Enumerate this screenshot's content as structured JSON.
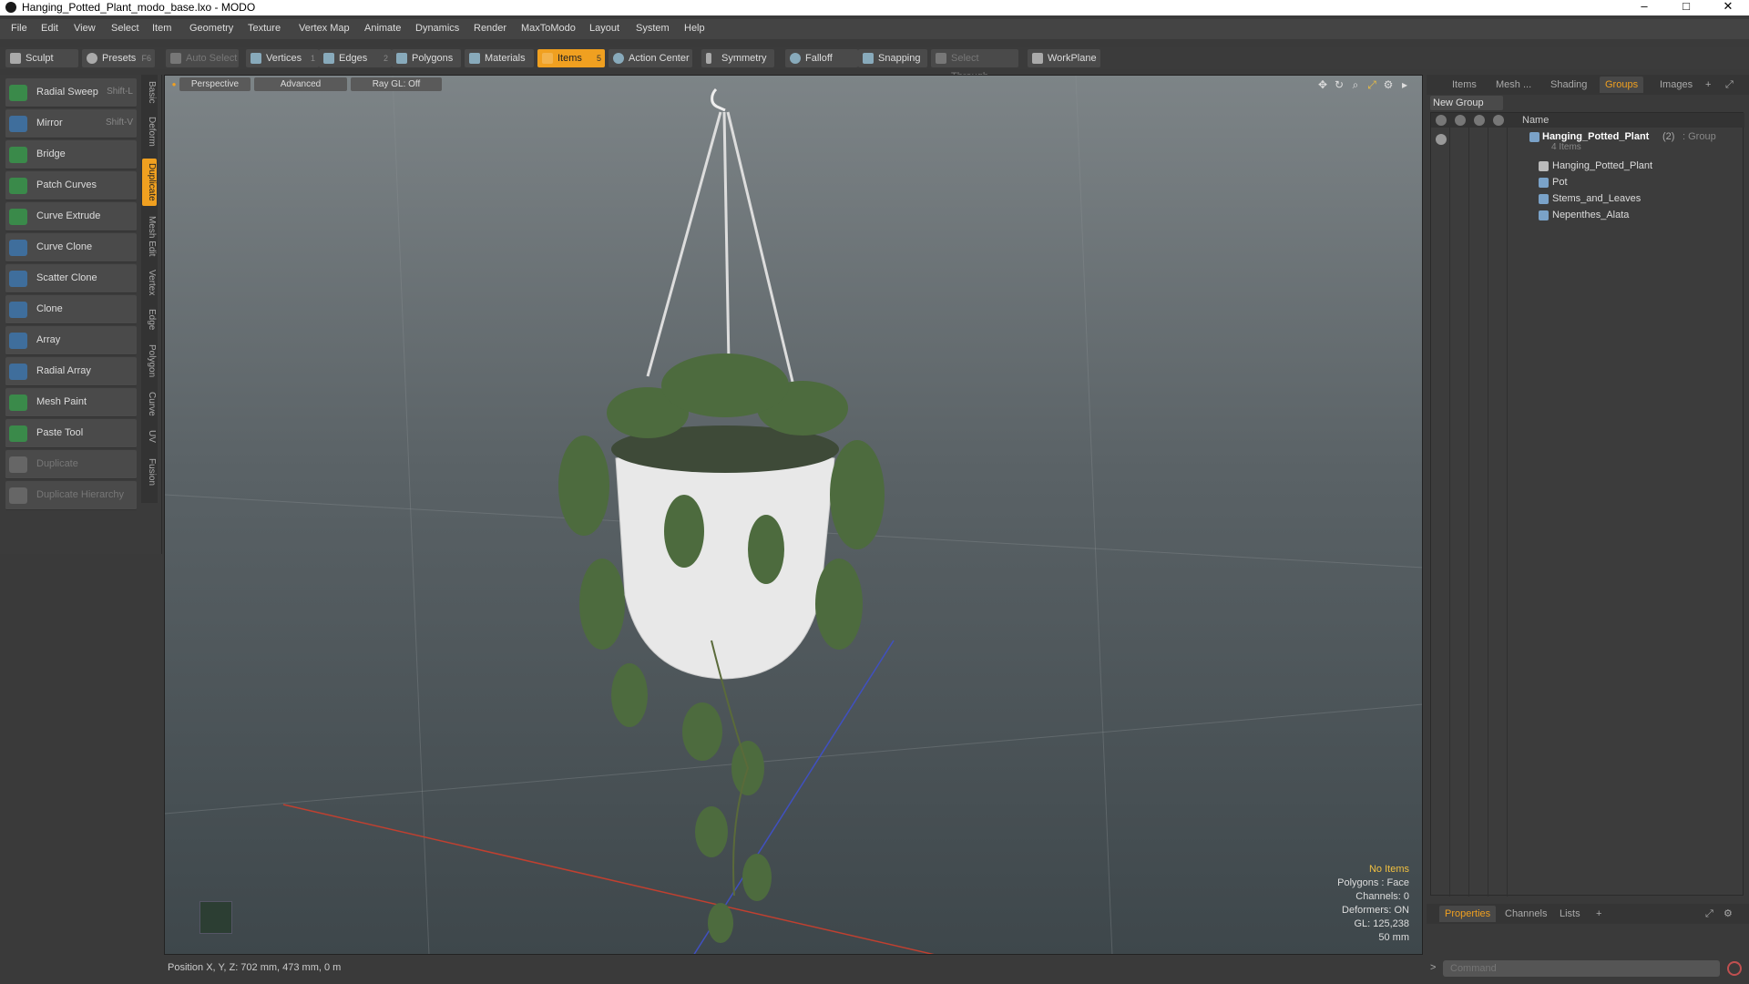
{
  "window": {
    "title": "Hanging_Potted_Plant_modo_base.lxo - MODO"
  },
  "menu": [
    "File",
    "Edit",
    "View",
    "Select",
    "Item",
    "Geometry",
    "Texture",
    "Vertex Map",
    "Animate",
    "Dynamics",
    "Render",
    "MaxToModo",
    "Layout",
    "System",
    "Help"
  ],
  "toolbar": {
    "sculpt": "Sculpt",
    "presets": "Presets",
    "presets_shortcut": "F6",
    "auto_select": "Auto Select",
    "vertices": "Vertices",
    "vertices_count": "1",
    "edges": "Edges",
    "edges_count": "2",
    "polygons": "Polygons",
    "materials": "Materials",
    "items": "Items",
    "items_count": "5",
    "action_center": "Action Center",
    "symmetry": "Symmetry",
    "falloff": "Falloff",
    "snapping": "Snapping",
    "select_through": "Select Through",
    "workplane": "WorkPlane"
  },
  "tools": [
    {
      "label": "Radial Sweep",
      "shortcut": "Shift-L",
      "icon": "radial-sweep-icon"
    },
    {
      "label": "Mirror",
      "shortcut": "Shift-V",
      "icon": "mirror-icon"
    },
    {
      "label": "Bridge",
      "shortcut": "",
      "icon": "bridge-icon"
    },
    {
      "label": "Patch Curves",
      "shortcut": "",
      "icon": "patch-curves-icon"
    },
    {
      "label": "Curve Extrude",
      "shortcut": "",
      "icon": "curve-extrude-icon"
    },
    {
      "label": "Curve Clone",
      "shortcut": "",
      "icon": "curve-clone-icon"
    },
    {
      "label": "Scatter Clone",
      "shortcut": "",
      "icon": "scatter-clone-icon"
    },
    {
      "label": "Clone",
      "shortcut": "",
      "icon": "clone-icon"
    },
    {
      "label": "Array",
      "shortcut": "",
      "icon": "array-icon"
    },
    {
      "label": "Radial Array",
      "shortcut": "",
      "icon": "radial-array-icon"
    },
    {
      "label": "Mesh Paint",
      "shortcut": "",
      "icon": "mesh-paint-icon"
    },
    {
      "label": "Paste Tool",
      "shortcut": "",
      "icon": "paste-tool-icon"
    },
    {
      "label": "Duplicate",
      "shortcut": "",
      "icon": "duplicate-icon"
    },
    {
      "label": "Duplicate Hierarchy",
      "shortcut": "",
      "icon": "duplicate-hierarchy-icon"
    }
  ],
  "vertical_tabs": [
    "Basic",
    "Deform",
    "Duplicate",
    "Mesh Edit",
    "Vertex",
    "Edge",
    "Polygon",
    "Curve",
    "UV",
    "Fusion"
  ],
  "viewport": {
    "view_mode": "Perspective",
    "shading": "Advanced",
    "raygl": "Ray GL: Off",
    "info": {
      "selection": "No Items",
      "polygons": "Polygons : Face",
      "channels": "Channels: 0",
      "deformers": "Deformers: ON",
      "gl": "GL: 125,238",
      "lens": "50 mm"
    }
  },
  "status": {
    "position": "Position X, Y, Z:  702 mm, 473 mm, 0 m"
  },
  "right_panel": {
    "tabs": [
      "Items",
      "Mesh ...",
      "Shading",
      "Groups",
      "Images"
    ],
    "new_group": "New Group",
    "column_name": "Name",
    "group": {
      "name": "Hanging_Potted_Plant",
      "count": "(2)",
      "type": ": Group",
      "items_label": "4 Items"
    },
    "items": [
      "Hanging_Potted_Plant",
      "Pot",
      "Stems_and_Leaves",
      "Nepenthes_Alata"
    ],
    "bottom_tabs": [
      "Properties",
      "Channels",
      "Lists"
    ],
    "command_placeholder": "Command"
  },
  "colors": {
    "accent": "#f0a020",
    "panel": "#3a3a3a",
    "viewport_top": "#7d8487",
    "viewport_bottom": "#3e474b"
  }
}
